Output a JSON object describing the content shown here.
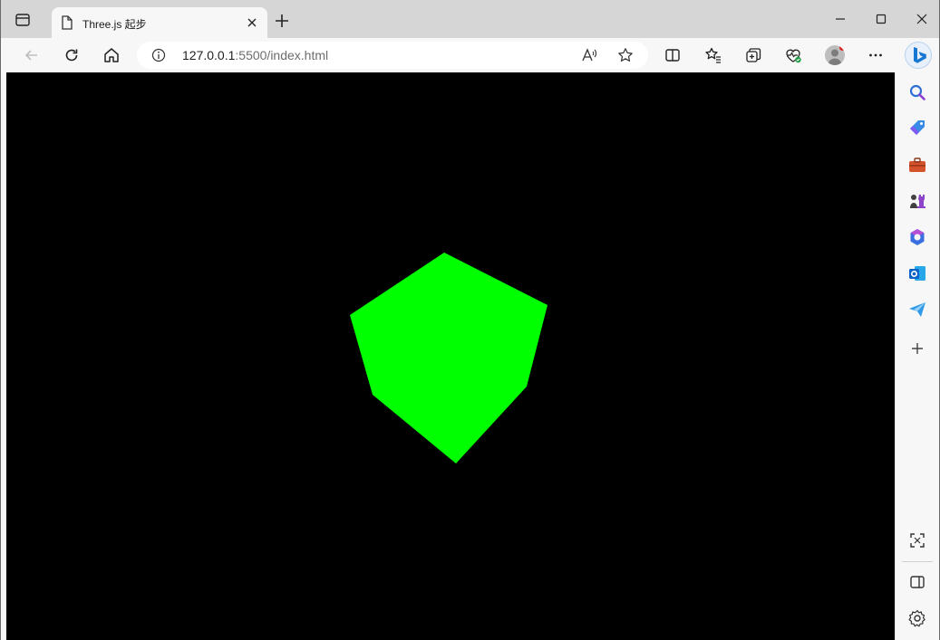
{
  "browser": {
    "tab": {
      "title": "Three.js 起步",
      "favicon": "page-icon"
    },
    "address": {
      "host": "127.0.0.1",
      "path": ":5500/index.html"
    },
    "toolbar_icons": [
      "back-arrow-icon",
      "reload-icon",
      "home-icon",
      "info-icon",
      "read-aloud-icon",
      "favorite-star-icon",
      "split-screen-icon",
      "favorites-icon",
      "collections-icon",
      "browser-essentials-icon",
      "profile-avatar-icon",
      "more-menu-icon",
      "bing-copilot-icon"
    ],
    "window_controls": [
      "minimize-icon",
      "maximize-icon",
      "close-icon"
    ]
  },
  "sidebar": {
    "items": [
      "search-icon",
      "shopping-tag-icon",
      "tools-briefcase-icon",
      "games-icon",
      "microsoft-365-icon",
      "outlook-icon",
      "drop-send-icon",
      "add-icon"
    ],
    "bottom": [
      "screenshot-icon",
      "hide-sidebar-icon",
      "settings-icon"
    ]
  },
  "scene": {
    "background": "#000000",
    "object": "cube",
    "color": "#00ff00"
  }
}
